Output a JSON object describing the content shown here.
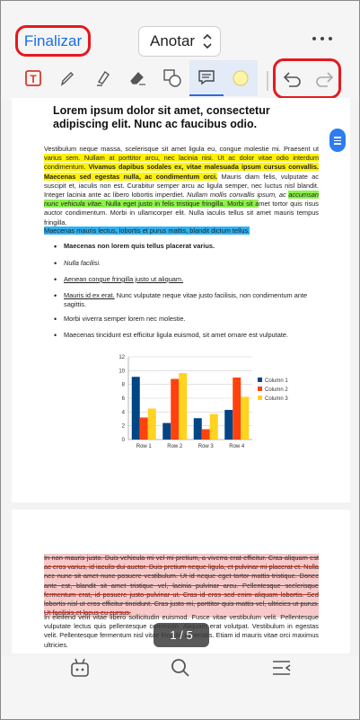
{
  "header": {
    "finalize_label": "Finalizar",
    "mode_label": "Anotar"
  },
  "toolbar": {
    "tools": [
      "text-box-icon",
      "pen-icon",
      "highlighter-icon",
      "eraser-icon",
      "shapes-icon",
      "comment-icon",
      "color-icon",
      "undo-icon",
      "redo-icon"
    ],
    "active_color": "#fff5a8",
    "accent": "#2a6ae0",
    "annotation_red": "#e5191e"
  },
  "document": {
    "title": "Lorem ipsum dolor sit amet, consectetur adipiscing elit. Nunc ac faucibus odio.",
    "para1": {
      "a": "Vestibulum neque massa, scelerisque sit amet ligula eu, congue molestie mi. Praesent ut ",
      "b": "varius sem. Nullam at porttitor arcu, nec lacinia nisi. Ut ac dolor vitae odio interdum condimentum.",
      "c": " Vivamus dapibus sodales ex, vitae malesuada ipsum cursus convallis. Maecenas sed egestas nulla, ac condimentum orci.",
      "d": " Mauris diam felis, vulputate ac suscipit et, iaculis non est. Curabitur semper arcu ac ligula semper, nec luctus nisl blandit. Integer lacinia ante ac libero lobortis imperdiet. ",
      "e": "Nullam mollis convallis ipsum, ac ",
      "f": "accumsan nunc vehicula vitae.",
      "g": " Nulla eget justo in felis tristique fringilla. Morbi sit a",
      "h": "met tortor quis risus auctor condimentum. Morbi in ullamcorper elit. Nulla iaculis tellus sit amet mauris tempus fringilla."
    },
    "para2": "Maecenas mauris lectus, lobortis et purus mattis, blandit dictum tellus.",
    "bullets": [
      "Maecenas non lorem quis tellus placerat varius.",
      "Nulla facilisi.",
      "Aenean congue fringilla justo ut aliquam.",
      "Mauris id ex erat.",
      " Nunc vulputate neque vitae justo facilisis, non condimentum ante sagittis.",
      "Morbi viverra semper lorem nec molestie.",
      "Maecenas tincidunt est efficitur ligula euismod, sit amet ornare est vulputate."
    ],
    "page2_para1": "In non mauris justo. Duis vehicula mi vel mi pretium, a viverra erat efficitur. Cras aliquam est ac eros varius, id iaculis dui auctor. Duis pretium neque ligula, et pulvinar mi placerat et. Nulla nec nunc sit amet nunc posuere vestibulum. Ut id neque eget tortor mattis tristique. Donec ante est, blandit sit amet tristique vel, lacinia pulvinar arcu. Pellentesque scelerisque fermentum erat, id posuere justo pulvinar ut. Cras id eros sed enim aliquam lobortis. Sed lobortis nisl ut eros efficitur tincidunt. Cras justo mi, porttitor quis mattis vel, ultricies ut purus. Ut facilisis et lacus eu cursus.",
    "page2_para2": "In eleifend velit vitae libero sollicitudin euismod. Fusce vitae vestibulum velit. Pellentesque vulputate lectus quis pellentesque commodo. Aliquam erat volutpat. Vestibulum in egestas velit. Pellentesque fermentum nisl vitae fringilla venenatis. Etiam id mauris vitae orci maximus ultricies."
  },
  "chart_data": {
    "type": "bar",
    "categories": [
      "Row 1",
      "Row 2",
      "Row 3",
      "Row 4"
    ],
    "series": [
      {
        "name": "Column 1",
        "values": [
          9.1,
          2.4,
          3.1,
          4.3
        ],
        "color": "#004586"
      },
      {
        "name": "Column 2",
        "values": [
          3.2,
          8.8,
          1.5,
          9.0
        ],
        "color": "#ff420e"
      },
      {
        "name": "Column 3",
        "values": [
          4.5,
          9.65,
          3.7,
          6.2
        ],
        "color": "#ffd320"
      }
    ],
    "ylim": [
      0,
      12
    ],
    "yticks": [
      "0",
      "2",
      "4",
      "6",
      "8",
      "10",
      "12"
    ],
    "grid": true,
    "legend": "right"
  },
  "pager": {
    "current": "1",
    "separator": "/",
    "total": "5"
  },
  "bottom_bar": {
    "icons": [
      "bot-icon",
      "search-icon",
      "outline-list-icon"
    ]
  }
}
